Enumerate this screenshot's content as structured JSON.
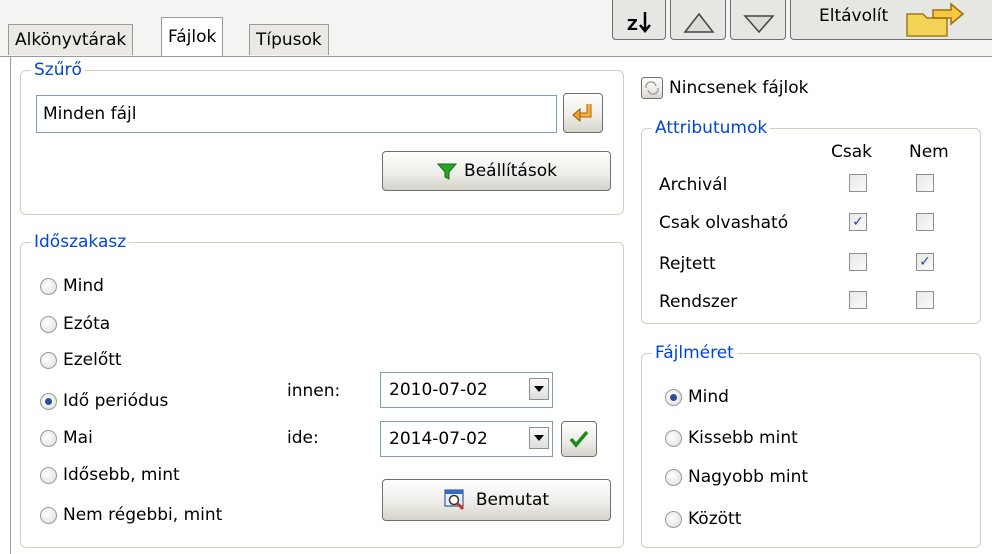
{
  "tabs": [
    "Alkönyvtárak",
    "Fájlok",
    "Típusok"
  ],
  "toolbar": {
    "remove_label": "Eltávolít"
  },
  "filter": {
    "title": "Szűrő",
    "value": "Minden fájl",
    "settings_label": "Beállítások"
  },
  "period": {
    "title": "Időszakasz",
    "options": [
      "Mind",
      "Ezóta",
      "Ezelőtt",
      "Idő periódus",
      "Mai",
      "Idősebb, mint",
      "Nem régebbi, mint"
    ],
    "selected": "Idő periódus",
    "from_label": "innen:",
    "from_value": "2010-07-02",
    "to_label": "ide:",
    "to_value": "2014-07-02",
    "show_label": "Bemutat"
  },
  "no_files_label": "Nincsenek fájlok",
  "attributes": {
    "title": "Attributumok",
    "col_only": "Csak",
    "col_not": "Nem",
    "rows": [
      {
        "label": "Archivál",
        "only": false,
        "not": false
      },
      {
        "label": "Csak olvasható",
        "only": true,
        "not": false
      },
      {
        "label": "Rejtett",
        "only": false,
        "not": true
      },
      {
        "label": "Rendszer",
        "only": false,
        "not": false
      }
    ]
  },
  "filesize": {
    "title": "Fájlméret",
    "options": [
      "Mind",
      "Kissebb mint",
      "Nagyobb mint",
      "Között"
    ],
    "selected": "Mind"
  },
  "colors": {
    "group_title": "#0046d5",
    "border": "#d0d0bf"
  }
}
